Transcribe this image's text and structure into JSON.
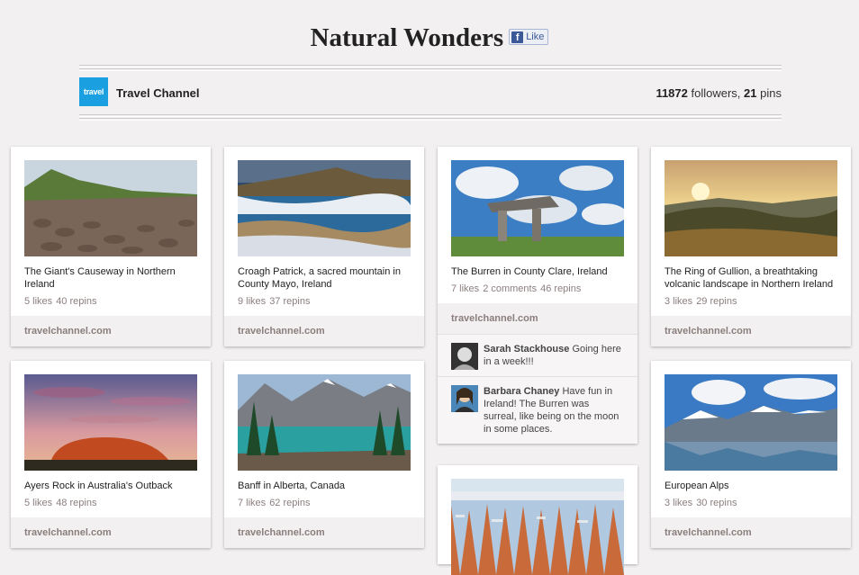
{
  "board": {
    "title": "Natural Wonders",
    "like_label": "Like",
    "like_icon": "facebook-icon"
  },
  "owner": {
    "logo_text": "travel",
    "name": "Travel Channel",
    "followers": "11872",
    "followers_label": "followers,",
    "pins": "21",
    "pins_label": "pins"
  },
  "pins": [
    {
      "description": "The Giant's Causeway in Northern Ireland",
      "likes": "5 likes",
      "comments": "",
      "repins": "40 repins",
      "source": "travelchannel.com"
    },
    {
      "description": "Croagh Patrick, a sacred mountain in County Mayo, Ireland",
      "likes": "9 likes",
      "comments": "",
      "repins": "37 repins",
      "source": "travelchannel.com"
    },
    {
      "description": "The Burren in County Clare, Ireland",
      "likes": "7 likes",
      "comments": "2 comments",
      "repins": "46 repins",
      "source": "travelchannel.com",
      "comment_list": [
        {
          "author": "Sarah Stackhouse",
          "text": "Going here in a week!!!"
        },
        {
          "author": "Barbara Chaney",
          "text": "Have fun in Ireland! The Burren was surreal, like being on the moon in some places."
        }
      ]
    },
    {
      "description": "The Ring of Gullion, a breathtaking volcanic landscape in Northern Ireland",
      "likes": "3 likes",
      "comments": "",
      "repins": "29 repins",
      "source": "travelchannel.com"
    },
    {
      "description": "Ayers Rock in Australia's Outback",
      "likes": "5 likes",
      "comments": "",
      "repins": "48 repins",
      "source": "travelchannel.com"
    },
    {
      "description": "Banff in Alberta, Canada",
      "likes": "7 likes",
      "comments": "",
      "repins": "62 repins",
      "source": "travelchannel.com"
    },
    {
      "description": "",
      "likes": "",
      "comments": "",
      "repins": "",
      "source": ""
    },
    {
      "description": "European Alps",
      "likes": "3 likes",
      "comments": "",
      "repins": "30 repins",
      "source": "travelchannel.com"
    }
  ]
}
